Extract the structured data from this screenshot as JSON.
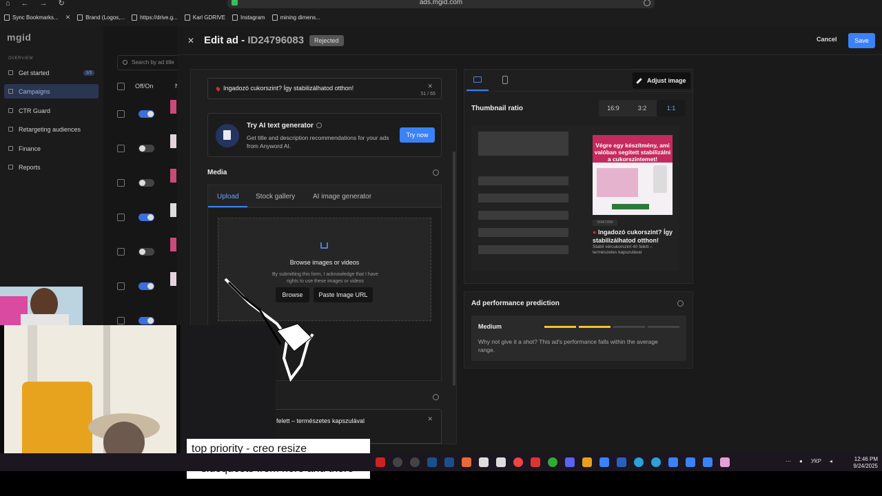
{
  "browser": {
    "url": "ads.mgid.com",
    "bookmarks": [
      "Sync Bookmarks...",
      "Brand (Logos,...",
      "https://drive.g...",
      "Karl GDRIVE",
      "Instagram",
      "mining dimens..."
    ]
  },
  "sidebar": {
    "logo": "mgid",
    "section": "OVERVIEW",
    "items": [
      {
        "label": "Get started",
        "badge": "1/3",
        "icon": "rocket-icon"
      },
      {
        "label": "Campaigns",
        "icon": "campaign-icon"
      },
      {
        "label": "CTR Guard",
        "icon": "shield-icon"
      },
      {
        "label": "Retargeting audiences",
        "icon": "audience-icon"
      },
      {
        "label": "Finance",
        "icon": "finance-icon"
      },
      {
        "label": "Reports",
        "icon": "report-icon"
      }
    ]
  },
  "list": {
    "search_placeholder": "Search by ad title",
    "col_offon": "Off/On",
    "col_n": "N",
    "toggles": [
      "on",
      "off",
      "off",
      "on",
      "off",
      "on",
      "on"
    ]
  },
  "drawer": {
    "title_prefix": "Edit ad - ",
    "ad_id": "ID24796083",
    "status": "Rejected",
    "cancel": "Cancel",
    "save": "Save"
  },
  "form": {
    "title_value": "Ingadozó cukorszint? Így stabilizálhatod otthon!",
    "title_counter": "51 / 65",
    "ai": {
      "title": "Try AI text generator",
      "desc": "Get title and description recommendations for your ads from Anyword AI.",
      "button": "Try now"
    },
    "media_label": "Media",
    "tabs": [
      "Upload",
      "Stock gallery",
      "AI image generator"
    ],
    "upload": {
      "title": "Browse images or videos",
      "note": "By submitting this form, I acknowledge that I have rights to use these images or videos",
      "browse": "Browse",
      "paste": "Paste Image URL"
    },
    "description_value": "felett – természetes kapszulával"
  },
  "preview": {
    "adjust": "Adjust image",
    "ratio_label": "Thumbnail ratio",
    "ratios": [
      "16:9",
      "3:2",
      "1:1"
    ],
    "active_ratio": "1:1",
    "image_headline": "Végre egy készítmény, ami valóban segített stabilizálni a cukorszintemet!",
    "sponsor": "DIAFORM",
    "ad_title": "Ingadozó cukorszint? Így stabilizálhatod otthon!",
    "ad_desc": "Stabil vércukorszint 40 felett – természetes kapszulával"
  },
  "performance": {
    "title": "Ad performance prediction",
    "level": "Medium",
    "level_fraction": 0.5,
    "text": "Why not give it a shot? This ad's performance falls within the average range."
  },
  "caption": {
    "line1": "top priority - creo resize",
    "line2": "+ sidequests from here and there"
  },
  "taskbar": {
    "lang": "УКР",
    "time": "12:46 PM",
    "date": "9/24/2025"
  }
}
